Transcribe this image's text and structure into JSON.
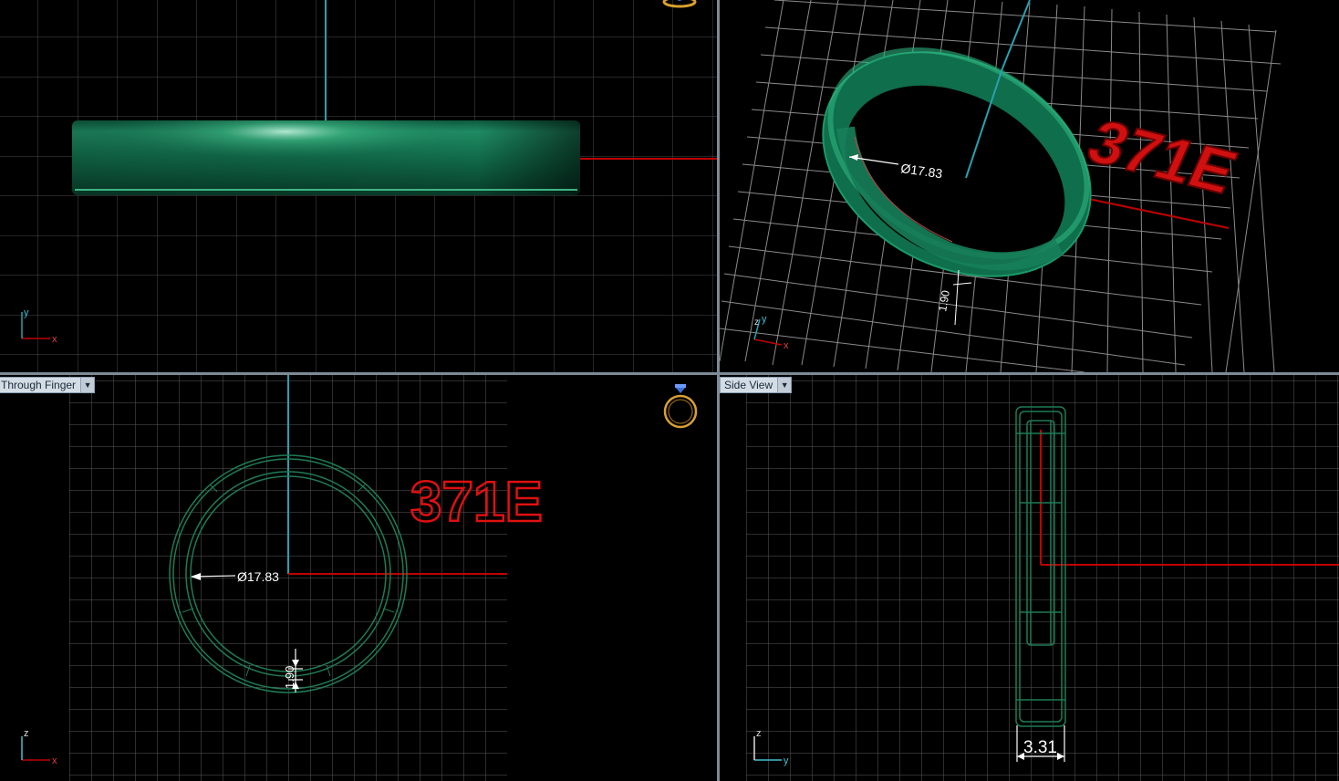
{
  "viewports": {
    "front": {
      "label": "",
      "axis_x": "x",
      "axis_y": "y"
    },
    "perspective": {
      "label": "",
      "axis_x": "x",
      "axis_y": "y",
      "axis_z": "z",
      "diameter": "Ø17.83",
      "thickness": "1.90",
      "engraving": "371E"
    },
    "through_finger": {
      "label": "Through Finger",
      "axis_x": "x",
      "axis_y": "z",
      "diameter": "Ø17.83",
      "thickness": "1.90",
      "engraving": "371E"
    },
    "side": {
      "label": "Side View",
      "axis_x": "y",
      "axis_y": "z",
      "width": "3.31"
    }
  },
  "icons": [
    "ring-icon",
    "dropdown-arrow-icon"
  ],
  "colors": {
    "grid": "#4a4a4a",
    "axis_red": "#c00000",
    "axis_teal": "#2aa0b0",
    "ring_green": "#1f8a62",
    "wire_green": "#1f7a55",
    "engraving_red": "#e01010"
  }
}
